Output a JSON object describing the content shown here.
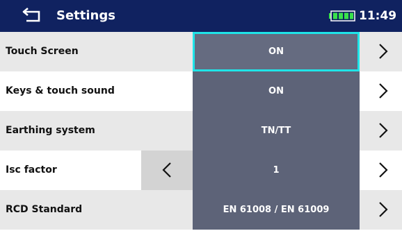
{
  "header": {
    "title": "Settings",
    "time": "11:49",
    "back_icon": "back-arrow-icon",
    "battery_icon": "battery-icon",
    "colors": {
      "bar": "#102260",
      "battery": "#39e24b"
    }
  },
  "rows": [
    {
      "label": "Touch Screen",
      "value": "ON",
      "selected": true,
      "has_prev": false
    },
    {
      "label": "Keys & touch sound",
      "value": "ON",
      "selected": false,
      "has_prev": false
    },
    {
      "label": "Earthing system",
      "value": "TN/TT",
      "selected": false,
      "has_prev": false
    },
    {
      "label": "Isc factor",
      "value": "1",
      "selected": false,
      "has_prev": true
    },
    {
      "label": "RCD Standard",
      "value": "EN 61008 / EN 61009",
      "selected": false,
      "has_prev": false
    }
  ],
  "colors": {
    "value_box": "#5d6378",
    "selection": "#1fe4e8"
  }
}
